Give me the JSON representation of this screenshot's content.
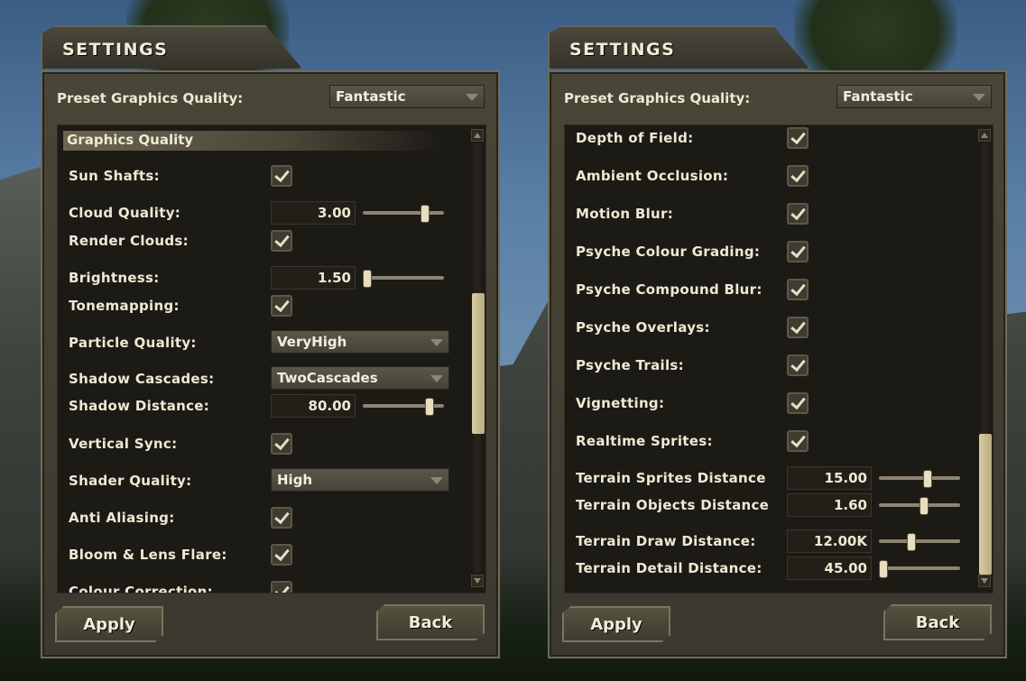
{
  "left": {
    "title": "SETTINGS",
    "preset_label": "Preset Graphics Quality:",
    "preset_value": "Fantastic",
    "section_header": "Graphics Quality",
    "rows": [
      {
        "label": "Sun Shafts:",
        "type": "check"
      },
      {
        "label": "Cloud Quality:",
        "type": "slider",
        "value": "3.00",
        "level": 0.78
      },
      {
        "label": "Render Clouds:",
        "type": "check"
      },
      {
        "label": "Brightness:",
        "type": "slider",
        "value": "1.50",
        "level": 0.0
      },
      {
        "label": "Tonemapping:",
        "type": "check"
      },
      {
        "label": "Particle Quality:",
        "type": "dropdown",
        "value": "VeryHigh"
      },
      {
        "label": "Shadow Cascades:",
        "type": "dropdown",
        "value": "TwoCascades"
      },
      {
        "label": "Shadow Distance:",
        "type": "slider",
        "value": "80.00",
        "level": 0.84
      },
      {
        "label": "Vertical Sync:",
        "type": "check"
      },
      {
        "label": "Shader Quality:",
        "type": "dropdown",
        "value": "High"
      },
      {
        "label": "Anti Aliasing:",
        "type": "check"
      },
      {
        "label": "Bloom & Lens Flare:",
        "type": "check"
      },
      {
        "label": "Colour Correction:",
        "type": "check"
      }
    ],
    "apply_label": "Apply",
    "back_label": "Back"
  },
  "right": {
    "title": "SETTINGS",
    "preset_label": "Preset Graphics Quality:",
    "preset_value": "Fantastic",
    "rows": [
      {
        "label": "Depth of Field:",
        "type": "check"
      },
      {
        "label": "Ambient Occlusion:",
        "type": "check"
      },
      {
        "label": "Motion Blur:",
        "type": "check"
      },
      {
        "label": "Psyche Colour Grading:",
        "type": "check"
      },
      {
        "label": "Psyche Compound Blur:",
        "type": "check"
      },
      {
        "label": "Psyche Overlays:",
        "type": "check"
      },
      {
        "label": "Psyche Trails:",
        "type": "check"
      },
      {
        "label": "Vignetting:",
        "type": "check"
      },
      {
        "label": "Realtime Sprites:",
        "type": "check"
      },
      {
        "label": "Terrain Sprites Distance",
        "type": "slider",
        "value": "15.00",
        "level": 0.6
      },
      {
        "label": "Terrain Objects Distance",
        "type": "slider",
        "value": "1.60",
        "level": 0.55
      },
      {
        "label": "Terrain Draw Distance:",
        "type": "slider",
        "value": "12.00K",
        "level": 0.38
      },
      {
        "label": "Terrain Detail Distance:",
        "type": "slider",
        "value": "45.00",
        "level": 0.0
      }
    ],
    "apply_label": "Apply",
    "back_label": "Back"
  },
  "colors": {
    "panel": "#3b392f",
    "text": "#efe9d4",
    "accent": "#d8cca0"
  }
}
